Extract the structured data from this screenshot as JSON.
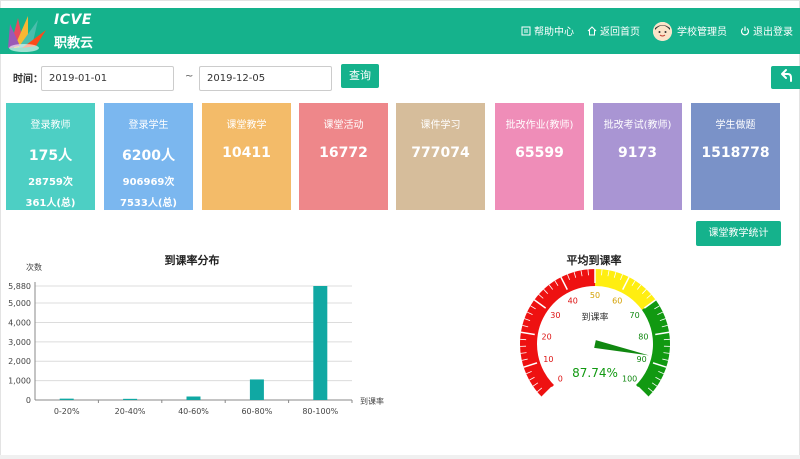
{
  "header": {
    "logo_text": "ICVE",
    "logo_subtext": "职教云",
    "nav": {
      "help": "帮助中心",
      "home": "返回首页",
      "user": "学校管理员",
      "logout": "退出登录"
    },
    "brand_color": "#15b28c"
  },
  "filter": {
    "time_label": "时间：",
    "start_date": "2019-01-01",
    "separator": "~",
    "end_date": "2019-12-05",
    "query_label": "查询"
  },
  "cards": [
    {
      "title": "登录教师",
      "value": "175人",
      "sub1": "28759次",
      "sub2": "361人(总)",
      "color": "#4dcfc4"
    },
    {
      "title": "登录学生",
      "value": "6200人",
      "sub1": "906969次",
      "sub2": "7533人(总)",
      "color": "#7bb7ef"
    },
    {
      "title": "课堂教学",
      "value": "10411",
      "sub1": "",
      "sub2": "",
      "color": "#f3bb69"
    },
    {
      "title": "课堂活动",
      "value": "16772",
      "sub1": "",
      "sub2": "",
      "color": "#ee878a"
    },
    {
      "title": "课件学习",
      "value": "777074",
      "sub1": "",
      "sub2": "",
      "color": "#d6bd9b"
    },
    {
      "title": "批改作业(教师)",
      "value": "65599",
      "sub1": "",
      "sub2": "",
      "color": "#ef8db8"
    },
    {
      "title": "批改考试(教师)",
      "value": "9173",
      "sub1": "",
      "sub2": "",
      "color": "#a995d3"
    },
    {
      "title": "学生做题",
      "value": "1518778",
      "sub1": "",
      "sub2": "",
      "color": "#7a92c8"
    }
  ],
  "stats_button": "课堂教学统计",
  "chart_data": [
    {
      "type": "bar",
      "title": "到课率分布",
      "ylabel": "次数",
      "xlabel": "到课率",
      "categories": [
        "0-20%",
        "20-40%",
        "40-60%",
        "60-80%",
        "80-100%"
      ],
      "values": [
        70,
        60,
        180,
        1060,
        5880
      ],
      "ylim": [
        0,
        5880
      ],
      "yticks": [
        "0",
        "1,000",
        "2,000",
        "3,000",
        "4,000",
        "5,000",
        "5,880"
      ],
      "ytick_values": [
        0,
        1000,
        2000,
        3000,
        4000,
        5000,
        5880
      ],
      "bar_color": "#10a8a3",
      "grid": true
    },
    {
      "type": "gauge",
      "title": "平均到课率",
      "label": "到课率",
      "value": 87.74,
      "value_text": "87.74%",
      "range": [
        0,
        100
      ],
      "ticks": [
        "0",
        "10",
        "20",
        "30",
        "40",
        "50",
        "60",
        "70",
        "80",
        "90",
        "100"
      ],
      "bands": [
        {
          "from": 0,
          "to": 50,
          "color": "#ee1111"
        },
        {
          "from": 50,
          "to": 70,
          "color": "#ffee11"
        },
        {
          "from": 70,
          "to": 100,
          "color": "#119911"
        }
      ],
      "value_color": "#119911"
    }
  ]
}
